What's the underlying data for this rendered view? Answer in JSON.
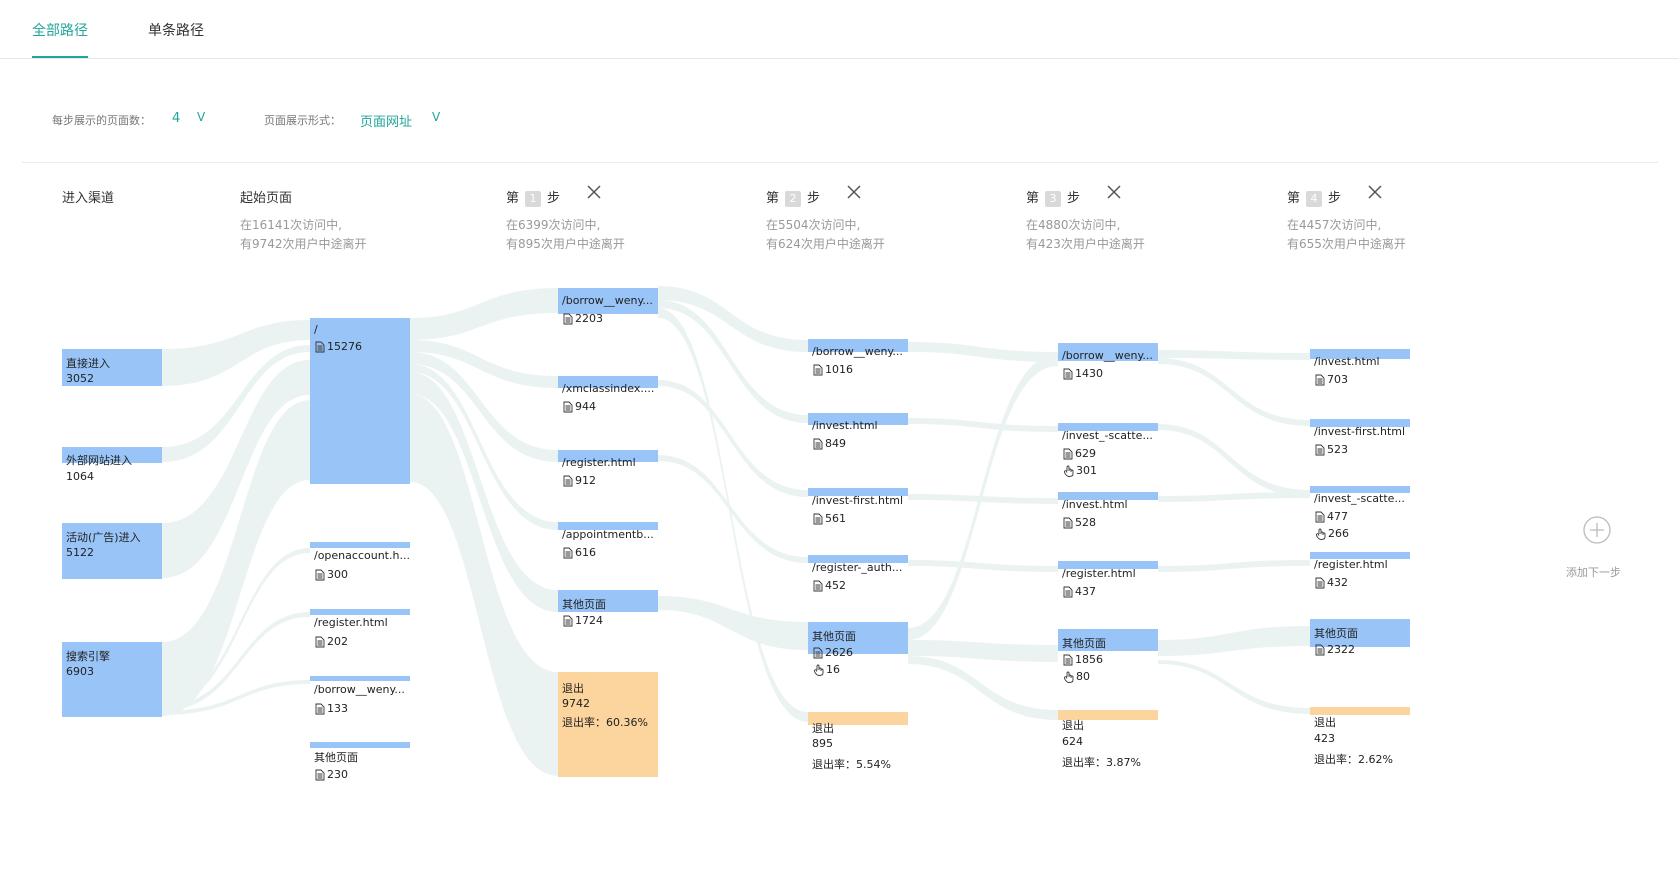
{
  "tabs": [
    {
      "label": "全部路径",
      "active": true
    },
    {
      "label": "单条路径",
      "active": false
    }
  ],
  "settings": {
    "pages_per_step_label": "每步展示的页面数：",
    "pages_per_step_value": "4",
    "display_mode_label": "页面展示形式：",
    "display_mode_value": "页面网址",
    "chevron": "V"
  },
  "columns": {
    "channel": {
      "title": "进入渠道"
    },
    "start": {
      "title": "起始页面",
      "sub1": "在16141次访问中,",
      "sub2": "有9742次用户中途离开"
    },
    "steps": [
      {
        "prefix": "第",
        "num": "1",
        "suffix": "步",
        "sub1": "在6399次访问中,",
        "sub2": "有895次用户中途离开"
      },
      {
        "prefix": "第",
        "num": "2",
        "suffix": "步",
        "sub1": "在5504次访问中,",
        "sub2": "有624次用户中途离开"
      },
      {
        "prefix": "第",
        "num": "3",
        "suffix": "步",
        "sub1": "在4880次访问中,",
        "sub2": "有423次用户中途离开"
      },
      {
        "prefix": "第",
        "num": "4",
        "suffix": "步",
        "sub1": "在4457次访问中,",
        "sub2": "有655次用户中途离开"
      }
    ]
  },
  "channels": [
    {
      "label": "直接进入",
      "count": "3052"
    },
    {
      "label": "外部网站进入",
      "count": "1064"
    },
    {
      "label": "活动(广告)进入",
      "count": "5122"
    },
    {
      "label": "搜索引擎",
      "count": "6903"
    }
  ],
  "start_pages": [
    {
      "label": "/",
      "count": "15276"
    },
    {
      "label": "/openaccount.h...",
      "count": "300"
    },
    {
      "label": "/register.html",
      "count": "202"
    },
    {
      "label": "/borrow__weny...",
      "count": "133"
    },
    {
      "label": "其他页面",
      "count": "230"
    }
  ],
  "step1": {
    "pages": [
      {
        "label": "/borrow__weny...",
        "count": "2203"
      },
      {
        "label": "/xmclassindex....",
        "count": "944"
      },
      {
        "label": "/register.html",
        "count": "912"
      },
      {
        "label": "/appointmentb...",
        "count": "616"
      },
      {
        "label": "其他页面",
        "count": "1724"
      }
    ],
    "exit": {
      "label": "退出",
      "count": "9742",
      "rate": "退出率：60.36%"
    }
  },
  "step2": {
    "pages": [
      {
        "label": "/borrow__weny...",
        "count": "1016"
      },
      {
        "label": "/invest.html",
        "count": "849"
      },
      {
        "label": "/invest-first.html",
        "count": "561"
      },
      {
        "label": "/register-_auth...",
        "count": "452"
      },
      {
        "label": "其他页面",
        "count": "2626",
        "clicks": "16"
      }
    ],
    "exit": {
      "label": "退出",
      "count": "895",
      "rate": "退出率：5.54%"
    }
  },
  "step3": {
    "pages": [
      {
        "label": "/borrow__weny...",
        "count": "1430"
      },
      {
        "label": "/invest_-scatte...",
        "count": "629",
        "clicks": "301"
      },
      {
        "label": "/invest.html",
        "count": "528"
      },
      {
        "label": "/register.html",
        "count": "437"
      },
      {
        "label": "其他页面",
        "count": "1856",
        "clicks": "80"
      }
    ],
    "exit": {
      "label": "退出",
      "count": "624",
      "rate": "退出率：3.87%"
    }
  },
  "step4": {
    "pages": [
      {
        "label": "/invest.html",
        "count": "703"
      },
      {
        "label": "/invest-first.html",
        "count": "523"
      },
      {
        "label": "/invest_-scatte...",
        "count": "477",
        "clicks": "266"
      },
      {
        "label": "/register.html",
        "count": "432"
      },
      {
        "label": "其他页面",
        "count": "2322"
      }
    ],
    "exit": {
      "label": "退出",
      "count": "423",
      "rate": "退出率：2.62%"
    }
  },
  "add_step": {
    "label": "添加下一步"
  },
  "colors": {
    "accent": "#22a59a",
    "node": "#99c4f7",
    "exit": "#fcd49d",
    "flow": "#e8f1f0"
  }
}
